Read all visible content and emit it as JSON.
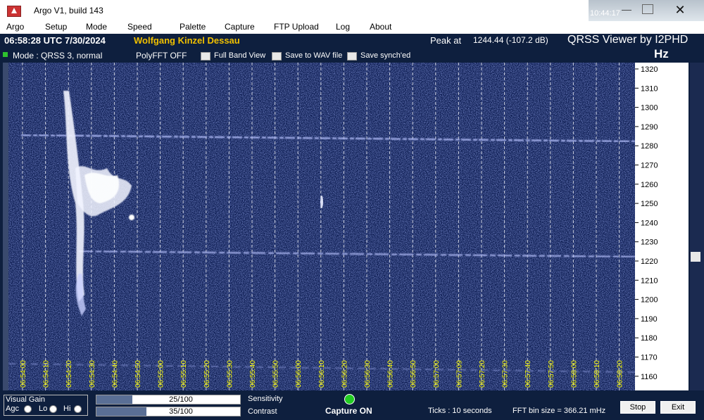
{
  "window": {
    "title": "Argo V1, build 143",
    "clock": "10:44:17"
  },
  "menu": [
    "Argo",
    "Setup",
    "Mode",
    "Speed",
    "Palette",
    "Capture",
    "FTP Upload",
    "Log",
    "About"
  ],
  "header": {
    "time": "06:58:28 UTC  7/30/2024",
    "station": "Wolfgang Kinzel Dessau",
    "peak_label": "Peak at",
    "peak_value": "1244.44 (-107.2 dB)",
    "viewer_title": "QRSS Viewer by I2PHD",
    "hz": "Hz",
    "mode": "Mode : QRSS 3, normal",
    "polyfft": "PolyFFT OFF",
    "checkboxes": [
      "Full Band View",
      "Save to WAV file",
      "Save synch'ed"
    ]
  },
  "freq_ticks": [
    "1320",
    "1310",
    "1300",
    "1290",
    "1280",
    "1270",
    "1260",
    "1250",
    "1240",
    "1230",
    "1220",
    "1210",
    "1200",
    "1190",
    "1180",
    "1170",
    "1160"
  ],
  "time_ticks": [
    "06:54:00",
    "06:54:10",
    "06:54:20",
    "06:54:30",
    "06:54:40",
    "06:54:50",
    "06:55:00",
    "06:55:10",
    "06:55:20",
    "06:55:30",
    "06:55:40",
    "06:55:50",
    "06:56:00",
    "06:56:10",
    "06:56:20",
    "06:56:30",
    "06:56:40",
    "06:56:50",
    "06:57:00",
    "06:57:09",
    "06:57:20",
    "06:57:30",
    "06:57:40",
    "06:57:50",
    "06:58:00",
    "06:58:10",
    "06:58:20"
  ],
  "bottom": {
    "visual_gain": "Visual Gain",
    "agc": "Agc",
    "lo": "Lo",
    "hi": "Hi",
    "sensitivity_value": "25/100",
    "sensitivity_fraction": 0.25,
    "sensitivity_label": "Sensitivity",
    "contrast_value": "35/100",
    "contrast_fraction": 0.35,
    "contrast_label": "Contrast",
    "capture_status": "Capture ON",
    "ticks": "Ticks  : 10 seconds",
    "fft_bin": "FFT bin size = 366.21 mHz",
    "stop": "Stop",
    "exit": "Exit"
  },
  "colors": {
    "background": "#0e1f3e",
    "spectrogram": "#0c1d52",
    "station": "#f0c000",
    "tick_label": "#ffff00"
  }
}
